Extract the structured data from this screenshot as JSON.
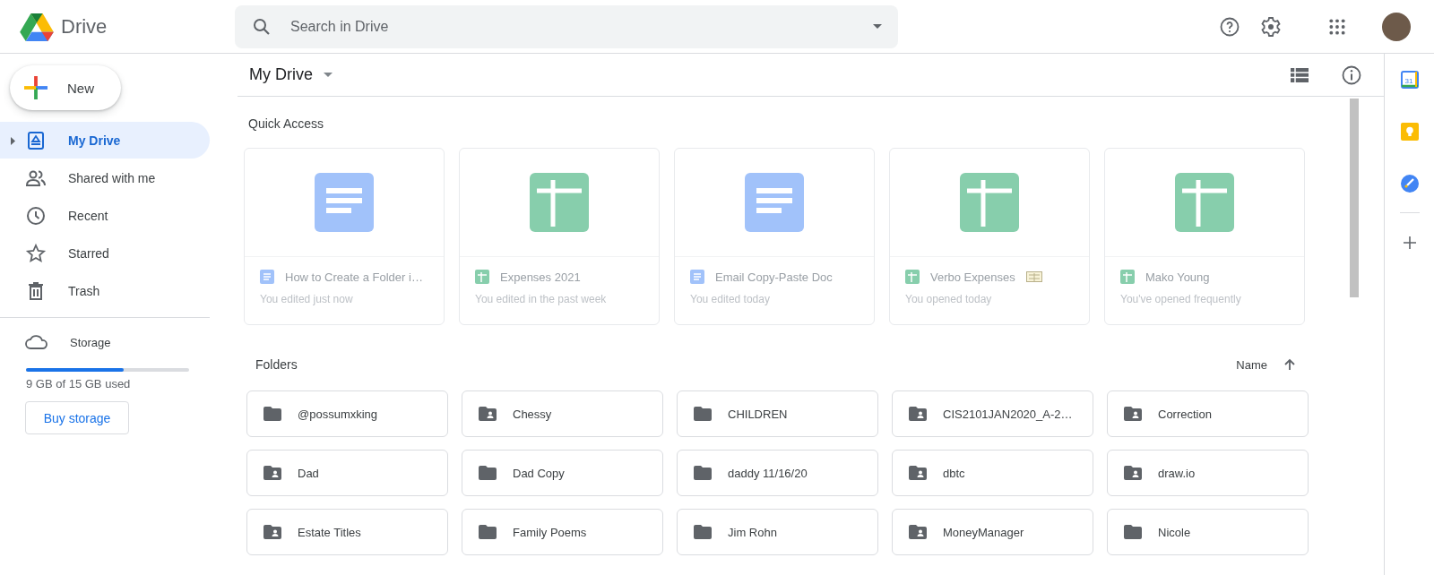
{
  "header": {
    "logo_text": "Drive",
    "search": {
      "placeholder": "Search in Drive"
    }
  },
  "sidebar": {
    "new_button": "New",
    "items": [
      {
        "label": "My Drive",
        "kind": "drive",
        "selected": true
      },
      {
        "label": "Shared with me",
        "kind": "people",
        "selected": false
      },
      {
        "label": "Recent",
        "kind": "clock",
        "selected": false
      },
      {
        "label": "Starred",
        "kind": "star",
        "selected": false
      },
      {
        "label": "Trash",
        "kind": "trash",
        "selected": false
      }
    ],
    "storage": {
      "label": "Storage",
      "level": 0.6,
      "usage": "9 GB of 15 GB used",
      "button": "Buy storage"
    }
  },
  "main": {
    "title": "My Drive",
    "quick_access": {
      "title": "Quick Access",
      "files": [
        {
          "name": "How to Create a Folder i…",
          "kind": "doc",
          "detail": "You edited just now",
          "tag_icon": false
        },
        {
          "name": "Expenses 2021",
          "kind": "sheet",
          "detail": "You edited in the past week",
          "tag_icon": false
        },
        {
          "name": "Email Copy-Paste Doc",
          "kind": "doc",
          "detail": "You edited today",
          "tag_icon": false
        },
        {
          "name": "Verbo Expenses",
          "kind": "sheet",
          "detail": "You opened today",
          "tag_icon": true
        },
        {
          "name": "Mako Young",
          "kind": "sheet",
          "detail": "You've opened frequently",
          "tag_icon": false
        }
      ]
    },
    "folders": {
      "title": "Folders",
      "sort_label": "Name",
      "items": [
        {
          "name": "@possumxking",
          "kind": "plain"
        },
        {
          "name": "Chessy",
          "kind": "shared"
        },
        {
          "name": "CHILDREN",
          "kind": "plain"
        },
        {
          "name": "CIS2101JAN2020_A-2…",
          "kind": "shared"
        },
        {
          "name": "Correction",
          "kind": "shared"
        },
        {
          "name": "Dad",
          "kind": "shared"
        },
        {
          "name": "Dad Copy",
          "kind": "plain"
        },
        {
          "name": "daddy 11/16/20",
          "kind": "plain"
        },
        {
          "name": "dbtc",
          "kind": "shared"
        },
        {
          "name": "draw.io",
          "kind": "shared"
        },
        {
          "name": "Estate Titles",
          "kind": "shared"
        },
        {
          "name": "Family Poems",
          "kind": "plain"
        },
        {
          "name": "Jim Rohn",
          "kind": "plain"
        },
        {
          "name": "MoneyManager",
          "kind": "shared"
        },
        {
          "name": "Nicole",
          "kind": "plain"
        }
      ]
    }
  },
  "side_panel": {
    "calendar_day": "31"
  }
}
